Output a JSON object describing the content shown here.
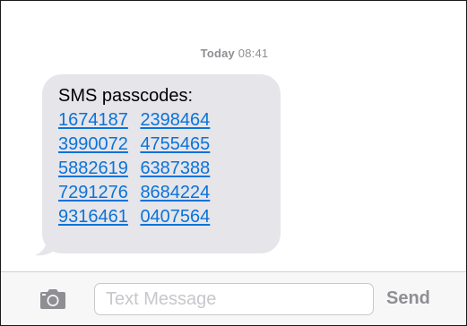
{
  "timestamp": {
    "day": "Today",
    "time": "08:41"
  },
  "message": {
    "header": "SMS passcodes:",
    "rows": [
      [
        "1674187",
        "2398464"
      ],
      [
        "3990072",
        "4755465"
      ],
      [
        "5882619",
        "6387388"
      ],
      [
        "7291276",
        "8684224"
      ],
      [
        "9316461",
        "0407564"
      ]
    ]
  },
  "compose": {
    "camera_icon": "camera-icon",
    "placeholder": "Text Message",
    "send_label": "Send"
  },
  "colors": {
    "bubble_background": "#e5e5ea",
    "link": "#0b72d8",
    "timestamp": "#8e8e93",
    "send_disabled": "#8e8e93",
    "input_bar": "#f7f7f7"
  }
}
